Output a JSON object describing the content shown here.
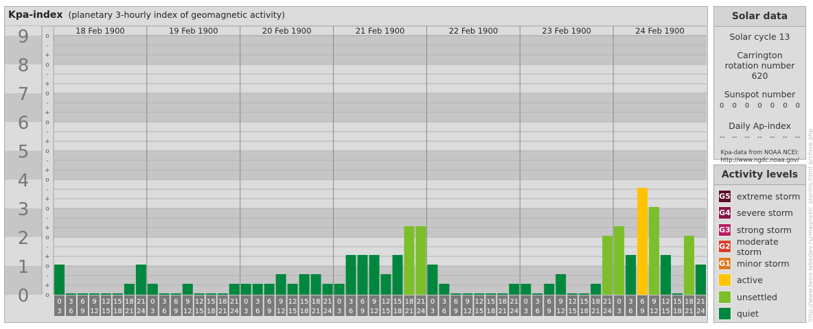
{
  "header": {
    "title": "Kpa-index",
    "subtitle": "(planetary 3-hourly index of geomagnetic activity)"
  },
  "chart_data": {
    "type": "bar",
    "title": "Kpa-index",
    "subtitle": "(planetary 3-hourly index of geomagnetic activity)",
    "ylim": [
      0,
      9
    ],
    "y_major_ticks": [
      "0",
      "1",
      "2",
      "3",
      "4",
      "5",
      "6",
      "7",
      "8",
      "9"
    ],
    "y_minor_ticks": [
      "o",
      "+",
      "-",
      "o"
    ],
    "days": [
      "18 Feb 1900",
      "19 Feb 1900",
      "20 Feb 1900",
      "21 Feb 1900",
      "22 Feb 1900",
      "23 Feb 1900",
      "24 Feb 1900"
    ],
    "interval_top_labels": [
      "0",
      "3",
      "6",
      "9",
      "12",
      "15",
      "18",
      "21"
    ],
    "interval_bottom_labels": [
      "3",
      "6",
      "9",
      "12",
      "15",
      "18",
      "21",
      "24"
    ],
    "values": [
      1.0,
      0.0,
      0.0,
      0.0,
      0.0,
      0.0,
      0.333,
      1.0,
      0.333,
      0.0,
      0.0,
      0.333,
      0.0,
      0.0,
      0.0,
      0.333,
      0.333,
      0.333,
      0.333,
      0.667,
      0.333,
      0.667,
      0.667,
      0.333,
      0.333,
      1.333,
      1.333,
      1.333,
      0.667,
      1.333,
      2.333,
      2.333,
      1.0,
      0.333,
      0.0,
      0.0,
      0.0,
      0.0,
      0.0,
      0.333,
      0.333,
      0.0,
      0.333,
      0.667,
      0.0,
      0.0,
      0.333,
      2.0,
      2.333,
      1.333,
      3.667,
      3.0,
      1.333,
      0.0,
      2.0,
      1.0
    ],
    "level_colors": {
      "quiet": "#00873e",
      "unsettled": "#7cbf2a",
      "active": "#ffc300",
      "minor_storm": "#e07a1f",
      "moderate_storm": "#d8402a",
      "strong_storm": "#b81e63",
      "severe_storm": "#8a1547",
      "extreme_storm": "#5c0b2a"
    },
    "grid": true,
    "legend": "right"
  },
  "solar": {
    "title": "Solar data",
    "cycle": "Solar cycle 13",
    "carrington": "Carrington rotation number 620",
    "sunspot_label": "Sunspot number",
    "sunspot_values": [
      "0",
      "0",
      "0",
      "0",
      "0",
      "0",
      "0"
    ],
    "ap_label": "Daily Ap-index",
    "ap_values": [
      "--",
      "--",
      "--",
      "--",
      "--",
      "--",
      "--"
    ],
    "source_line1": "Kpa-data from NOAA NCEI:",
    "source_line2": "http://www.ngdc.noaa.gov/"
  },
  "activity": {
    "title": "Activity levels",
    "levels": [
      {
        "badge": "G5",
        "label": "extreme storm",
        "color": "#5c0b2a"
      },
      {
        "badge": "G4",
        "label": "severe storm",
        "color": "#8a1547"
      },
      {
        "badge": "G3",
        "label": "strong storm",
        "color": "#b81e63"
      },
      {
        "badge": "G2",
        "label": "moderate storm",
        "color": "#d8402a"
      },
      {
        "badge": "G1",
        "label": "minor storm",
        "color": "#e07a1f"
      },
      {
        "badge": "",
        "label": "active",
        "color": "#ffc300"
      },
      {
        "badge": "",
        "label": "unsettled",
        "color": "#7cbf2a"
      },
      {
        "badge": "",
        "label": "quiet",
        "color": "#00873e"
      }
    ]
  },
  "watermark": "http://www.tesis.lebedev.ru/magnetic_storms.html  archive.php"
}
